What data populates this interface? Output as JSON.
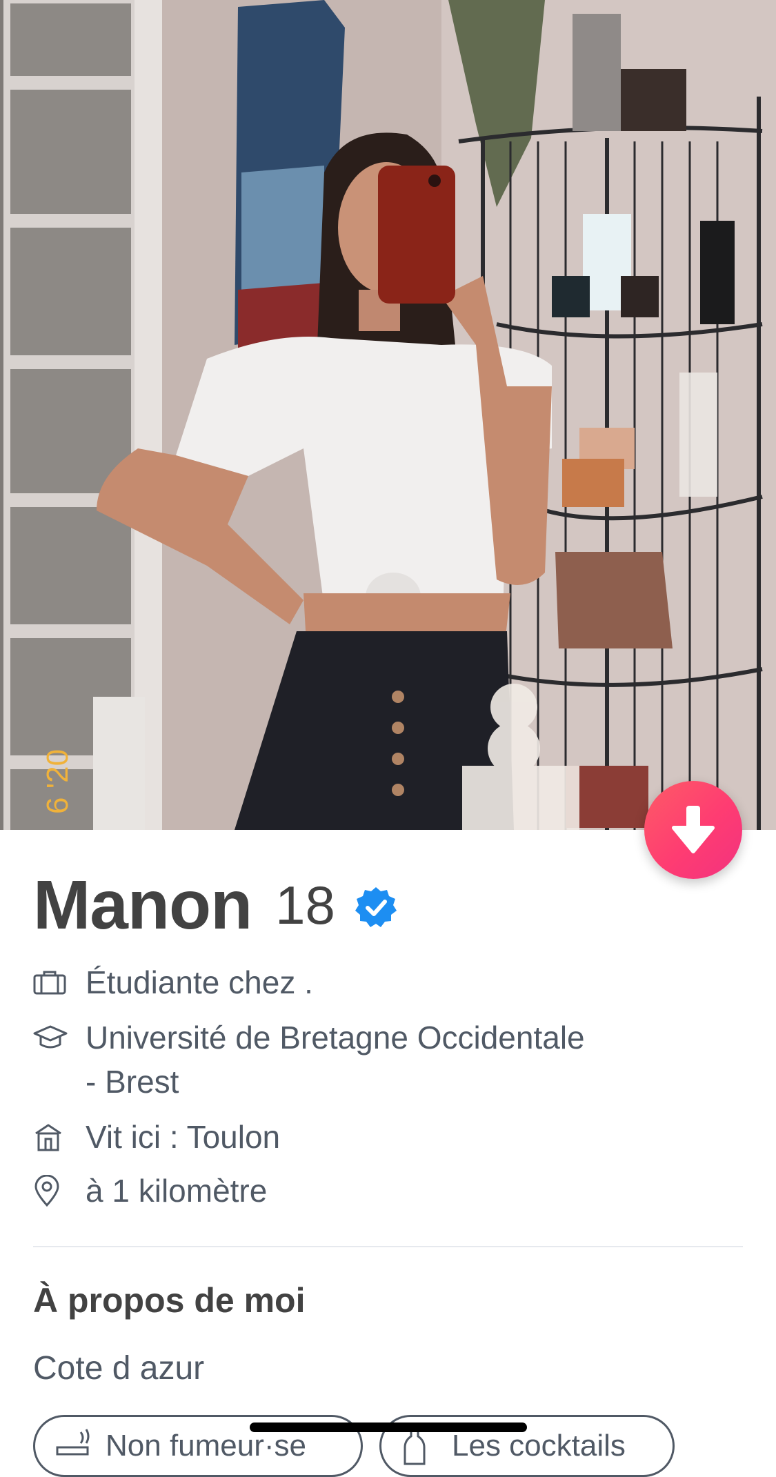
{
  "profile": {
    "name": "Manon",
    "age": "18",
    "job": "Étudiante chez .",
    "school_line1": "Université de Bretagne Occidentale",
    "school_line2": "- Brest",
    "lives": "Vit ici : Toulon",
    "distance": "à 1 kilomètre"
  },
  "about": {
    "title": "À propos de moi",
    "text": "Cote d azur"
  },
  "interests": [
    {
      "label": "Non fumeur·se",
      "icon": "smoking-icon"
    },
    {
      "label": "Les cocktails",
      "icon": "bottle-icon"
    }
  ],
  "photo": {
    "date_stamp": "6 '20"
  },
  "icons": {
    "scroll_down": "arrow-down-icon",
    "verified": "verified-badge-icon",
    "job": "briefcase-icon",
    "school": "graduation-cap-icon",
    "home": "house-icon",
    "location": "location-pin-icon"
  },
  "colors": {
    "accent_gradient_start": "#fd5b66",
    "accent_gradient_end": "#f2327f",
    "verified_blue": "#1d8ef2",
    "text_dark": "#424242",
    "text_secondary": "#505965"
  }
}
